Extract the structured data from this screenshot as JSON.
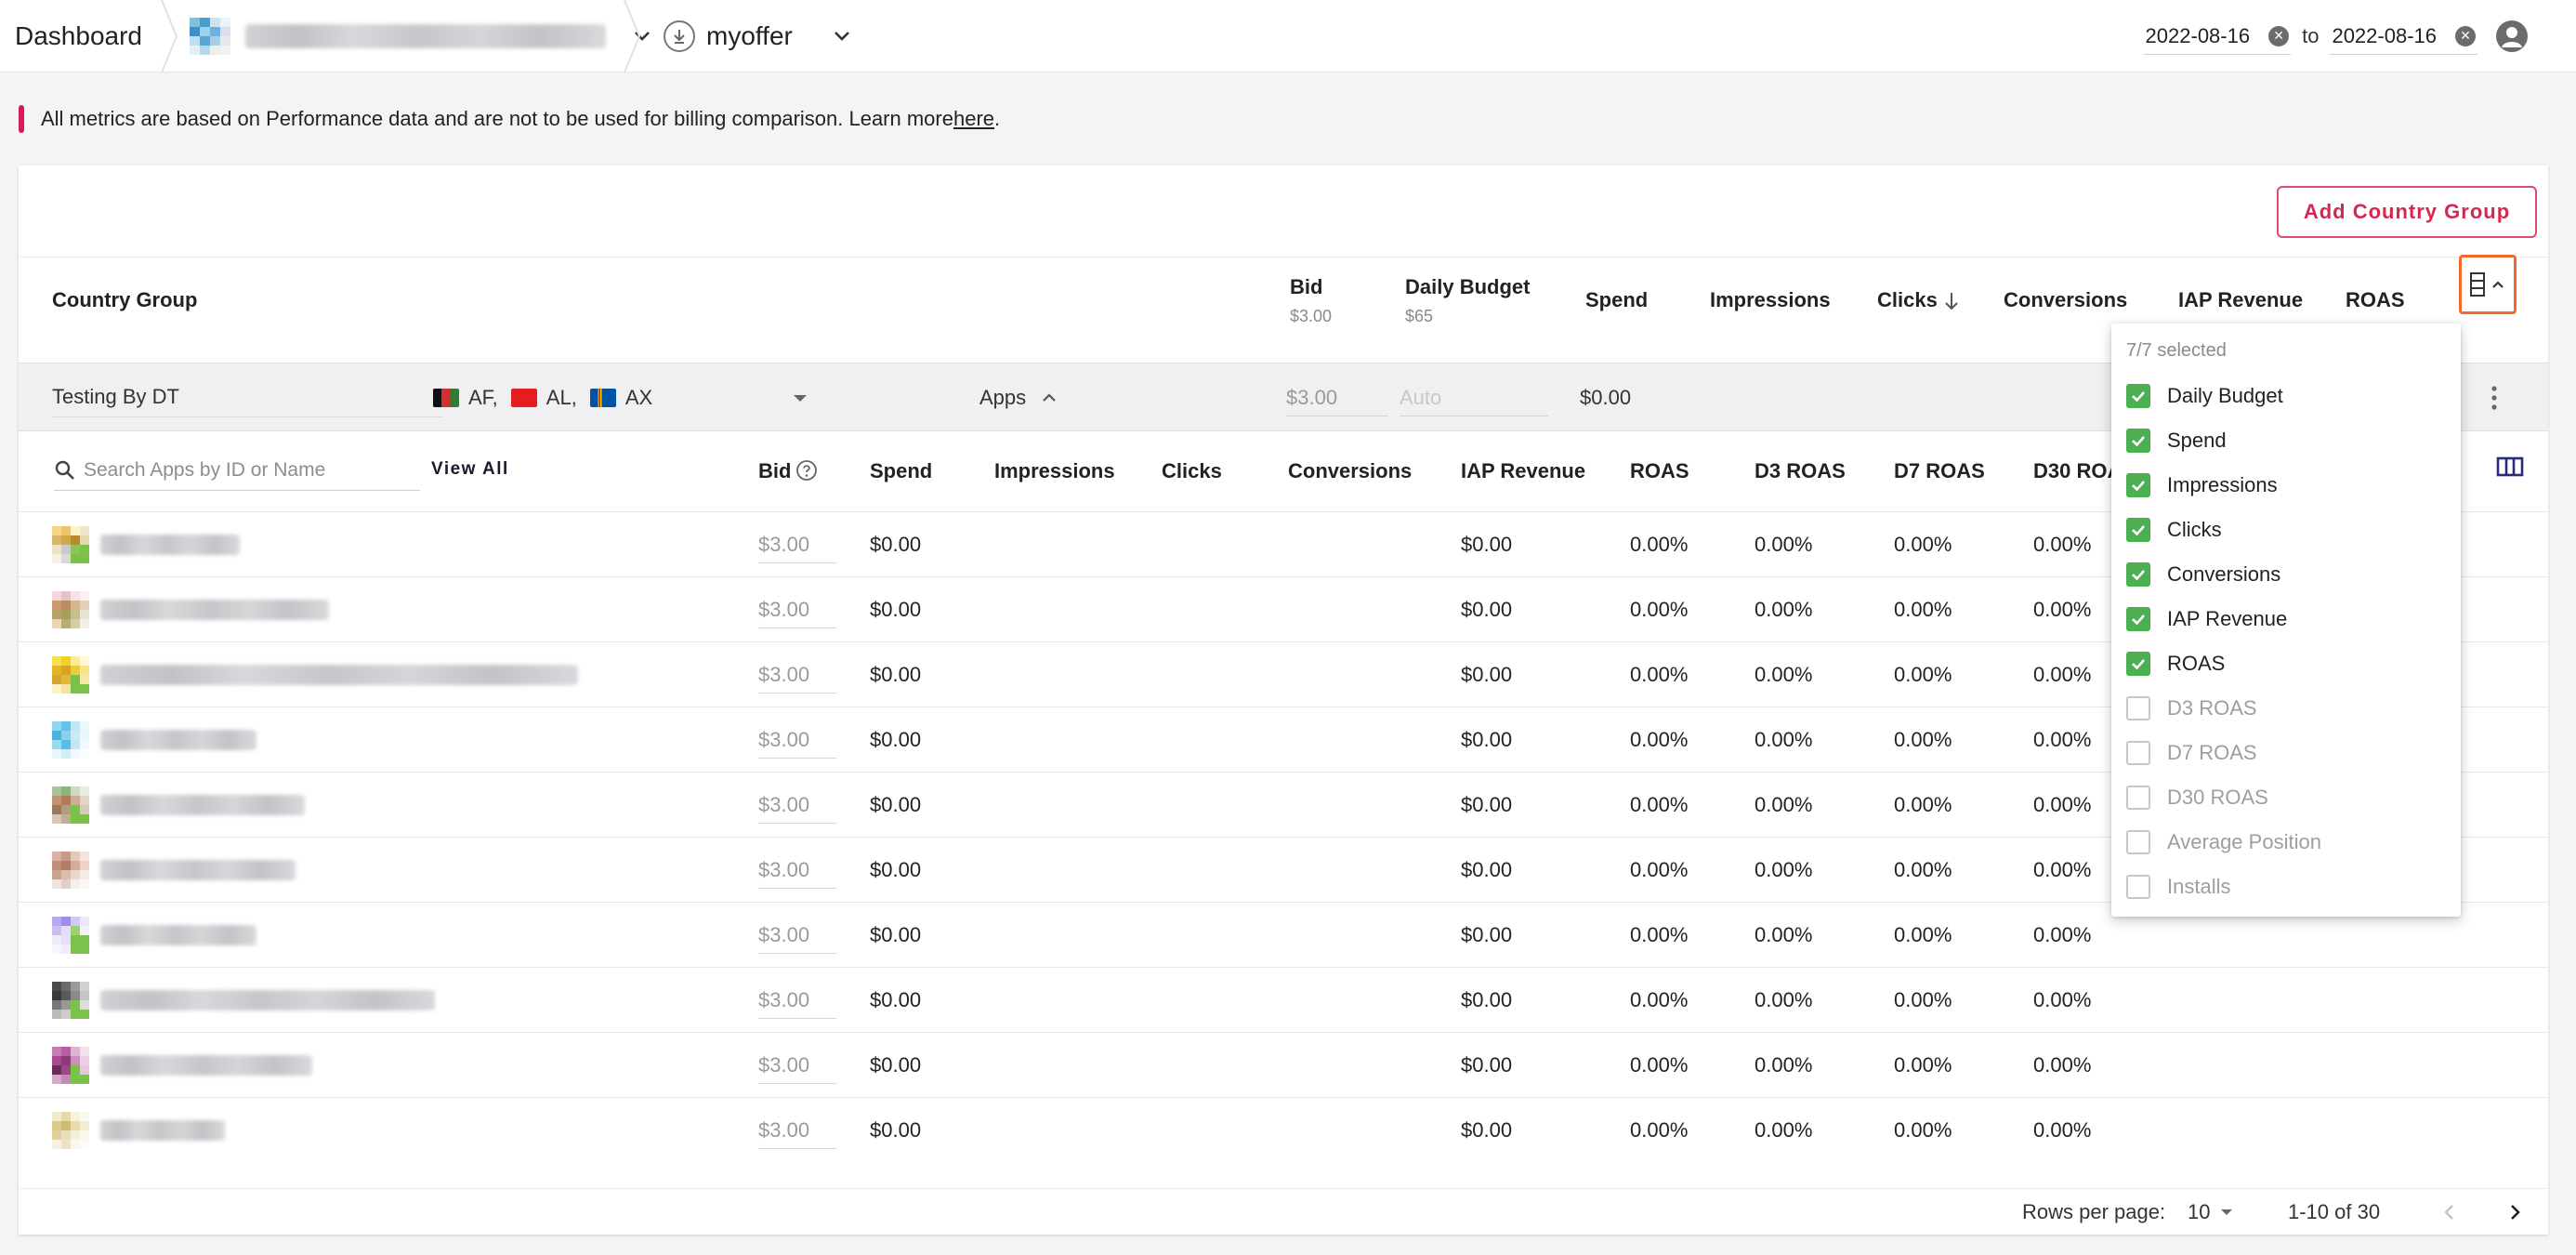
{
  "topbar": {
    "dashboard_label": "Dashboard",
    "offer_name": "myoffer",
    "date_from": "2022-08-16",
    "date_to": "2022-08-16",
    "to_label": "to"
  },
  "notice": {
    "text": "All metrics are based on Performance data and are not to be used for billing comparison. Learn more ",
    "link": "here",
    "end": "."
  },
  "colors": {
    "accent": "#d32850",
    "highlight": "#f06a2c",
    "check": "#4caf50",
    "notice_bar": "#d81b60"
  },
  "add_country_group_label": "Add Country Group",
  "cg_header": {
    "country_group": "Country Group",
    "bid": "Bid",
    "bid_sub": "$3.00",
    "daily_budget": "Daily Budget",
    "daily_budget_sub": "$65",
    "spend": "Spend",
    "impressions": "Impressions",
    "clicks": "Clicks",
    "conversions": "Conversions",
    "iap_revenue": "IAP Revenue",
    "roas": "ROAS"
  },
  "cg_row": {
    "name": "Testing By DT",
    "countries": [
      "AF,",
      "AL,",
      "AX"
    ],
    "apps_label": "Apps",
    "bid": "$3.00",
    "budget_placeholder": "Auto",
    "spend": "$0.00"
  },
  "apps_table": {
    "search_placeholder": "Search Apps by ID or Name",
    "view_all": "View All",
    "headers": [
      "Bid",
      "Spend",
      "Impressions",
      "Clicks",
      "Conversions",
      "IAP Revenue",
      "ROAS",
      "D3 ROAS",
      "D7 ROAS",
      "D30 ROAS"
    ],
    "rows": [
      {
        "bid": "$3.00",
        "spend": "$0.00",
        "iap": "$0.00",
        "roas": "0.00%",
        "d3": "0.00%",
        "d7": "0.00%",
        "d30": "0.00%"
      },
      {
        "bid": "$3.00",
        "spend": "$0.00",
        "iap": "$0.00",
        "roas": "0.00%",
        "d3": "0.00%",
        "d7": "0.00%",
        "d30": "0.00%"
      },
      {
        "bid": "$3.00",
        "spend": "$0.00",
        "iap": "$0.00",
        "roas": "0.00%",
        "d3": "0.00%",
        "d7": "0.00%",
        "d30": "0.00%"
      },
      {
        "bid": "$3.00",
        "spend": "$0.00",
        "iap": "$0.00",
        "roas": "0.00%",
        "d3": "0.00%",
        "d7": "0.00%",
        "d30": "0.00%"
      },
      {
        "bid": "$3.00",
        "spend": "$0.00",
        "iap": "$0.00",
        "roas": "0.00%",
        "d3": "0.00%",
        "d7": "0.00%",
        "d30": "0.00%"
      },
      {
        "bid": "$3.00",
        "spend": "$0.00",
        "iap": "$0.00",
        "roas": "0.00%",
        "d3": "0.00%",
        "d7": "0.00%",
        "d30": "0.00%"
      },
      {
        "bid": "$3.00",
        "spend": "$0.00",
        "iap": "$0.00",
        "roas": "0.00%",
        "d3": "0.00%",
        "d7": "0.00%",
        "d30": "0.00%"
      },
      {
        "bid": "$3.00",
        "spend": "$0.00",
        "iap": "$0.00",
        "roas": "0.00%",
        "d3": "0.00%",
        "d7": "0.00%",
        "d30": "0.00%"
      },
      {
        "bid": "$3.00",
        "spend": "$0.00",
        "iap": "$0.00",
        "roas": "0.00%",
        "d3": "0.00%",
        "d7": "0.00%",
        "d30": "0.00%"
      },
      {
        "bid": "$3.00",
        "spend": "$0.00",
        "iap": "$0.00",
        "roas": "0.00%",
        "d3": "0.00%",
        "d7": "0.00%",
        "d30": "0.00%"
      }
    ]
  },
  "pagination": {
    "rows_per_page_label": "Rows per page:",
    "rows_per_page": "10",
    "range": "1-10 of 30"
  },
  "column_menu": {
    "selected_count": "7/7 selected",
    "options": [
      {
        "label": "Daily Budget",
        "checked": true
      },
      {
        "label": "Spend",
        "checked": true
      },
      {
        "label": "Impressions",
        "checked": true
      },
      {
        "label": "Clicks",
        "checked": true
      },
      {
        "label": "Conversions",
        "checked": true
      },
      {
        "label": "IAP Revenue",
        "checked": true
      },
      {
        "label": "ROAS",
        "checked": true
      },
      {
        "label": "D3 ROAS",
        "checked": false
      },
      {
        "label": "D7 ROAS",
        "checked": false
      },
      {
        "label": "D30 ROAS",
        "checked": false
      },
      {
        "label": "Average Position",
        "checked": false
      },
      {
        "label": "Installs",
        "checked": false
      }
    ]
  }
}
